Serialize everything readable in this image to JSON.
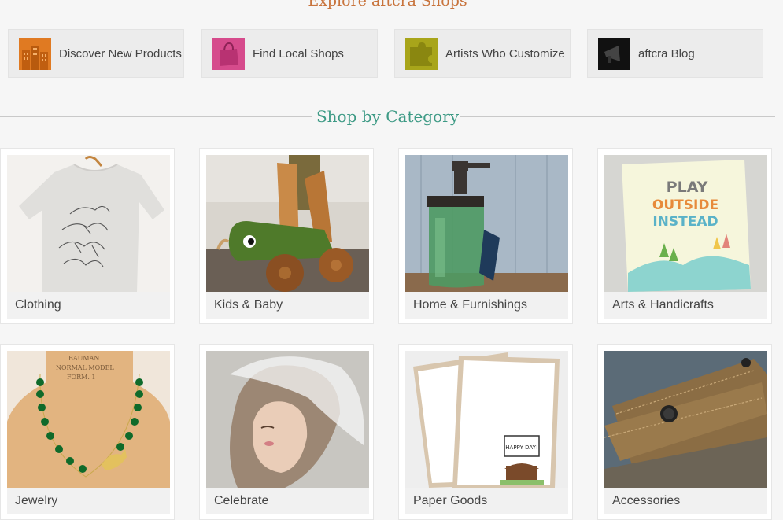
{
  "explore": {
    "title": "Explore aftcra Shops",
    "items": [
      {
        "label": "Discover New Products",
        "icon": "buildings-icon",
        "color": "#e07a22"
      },
      {
        "label": "Find Local Shops",
        "icon": "shopping-bag-icon",
        "color": "#d64b8c"
      },
      {
        "label": "Artists Who Customize",
        "icon": "puzzle-icon",
        "color": "#a8a51a"
      },
      {
        "label": "aftcra Blog",
        "icon": "megaphone-icon",
        "color": "#111111"
      }
    ]
  },
  "category": {
    "title": "Shop by Category",
    "items": [
      {
        "label": "Clothing",
        "image": "t-shirt-image"
      },
      {
        "label": "Kids & Baby",
        "image": "wooden-toy-image"
      },
      {
        "label": "Home & Furnishings",
        "image": "soap-dispenser-image"
      },
      {
        "label": "Arts & Handicrafts",
        "image": "art-print-image"
      },
      {
        "label": "Jewelry",
        "image": "necklace-image"
      },
      {
        "label": "Celebrate",
        "image": "bridal-veil-image"
      },
      {
        "label": "Paper Goods",
        "image": "greeting-cards-image"
      },
      {
        "label": "Accessories",
        "image": "leather-wallet-image"
      }
    ],
    "art_print_text": [
      "PLAY",
      "OUTSIDE",
      "INSTEAD"
    ],
    "card_banner_text": "HAPPY DAY!"
  }
}
